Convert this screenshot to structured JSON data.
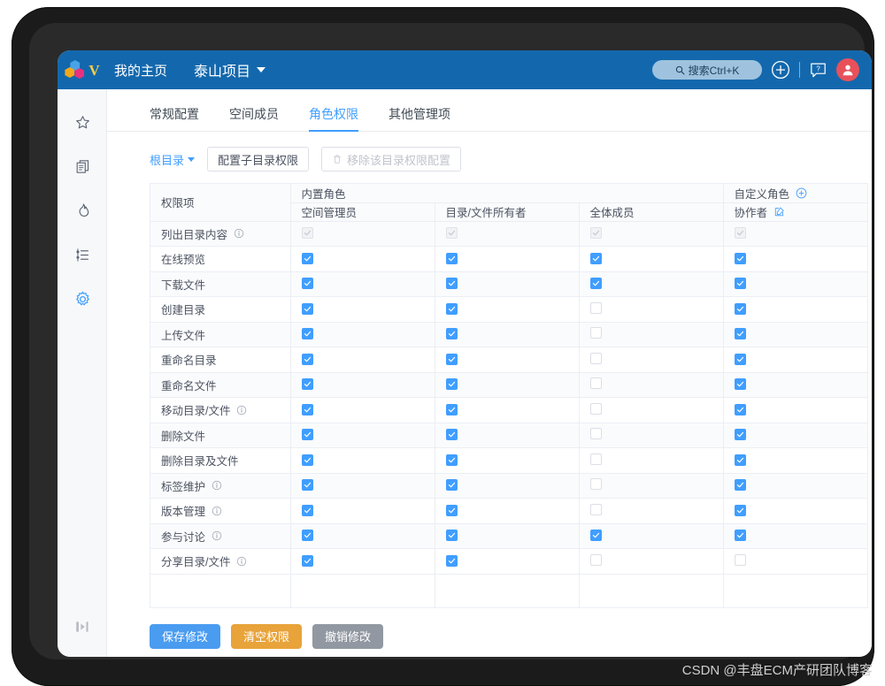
{
  "topbar": {
    "logo_letter": "V",
    "home_label": "我的主页",
    "project_label": "泰山项目",
    "search_placeholder": "搜索Ctrl+K",
    "search_value": "搜索Ctrl+K"
  },
  "tabs": [
    {
      "label": "常规配置",
      "active": false
    },
    {
      "label": "空间成员",
      "active": false
    },
    {
      "label": "角色权限",
      "active": true
    },
    {
      "label": "其他管理项",
      "active": false
    }
  ],
  "toolbar": {
    "root_dir_label": "根目录",
    "config_sub_label": "配置子目录权限",
    "remove_label": "移除该目录权限配置"
  },
  "table": {
    "perm_header": "权限项",
    "builtin_group": "内置角色",
    "custom_group": "自定义角色",
    "columns": [
      "空间管理员",
      "目录/文件所有者",
      "全体成员",
      "协作者"
    ],
    "rows": [
      {
        "label": "列出目录内容",
        "info": true,
        "states": [
          "dis",
          "dis",
          "dis",
          "dis"
        ]
      },
      {
        "label": "在线预览",
        "info": false,
        "states": [
          "on",
          "on",
          "on",
          "on"
        ]
      },
      {
        "label": "下载文件",
        "info": false,
        "states": [
          "on",
          "on",
          "on",
          "on"
        ]
      },
      {
        "label": "创建目录",
        "info": false,
        "states": [
          "on",
          "on",
          "off",
          "on"
        ]
      },
      {
        "label": "上传文件",
        "info": false,
        "states": [
          "on",
          "on",
          "off",
          "on"
        ]
      },
      {
        "label": "重命名目录",
        "info": false,
        "states": [
          "on",
          "on",
          "off",
          "on"
        ]
      },
      {
        "label": "重命名文件",
        "info": false,
        "states": [
          "on",
          "on",
          "off",
          "on"
        ]
      },
      {
        "label": "移动目录/文件",
        "info": true,
        "states": [
          "on",
          "on",
          "off",
          "on"
        ]
      },
      {
        "label": "删除文件",
        "info": false,
        "states": [
          "on",
          "on",
          "off",
          "on"
        ]
      },
      {
        "label": "删除目录及文件",
        "info": false,
        "states": [
          "on",
          "on",
          "off",
          "on"
        ]
      },
      {
        "label": "标签维护",
        "info": true,
        "states": [
          "on",
          "on",
          "off",
          "on"
        ]
      },
      {
        "label": "版本管理",
        "info": true,
        "states": [
          "on",
          "on",
          "off",
          "on"
        ]
      },
      {
        "label": "参与讨论",
        "info": true,
        "states": [
          "on",
          "on",
          "on",
          "on"
        ]
      },
      {
        "label": "分享目录/文件",
        "info": true,
        "states": [
          "on",
          "on",
          "off",
          "off"
        ]
      }
    ]
  },
  "footer": {
    "save_label": "保存修改",
    "clear_label": "清空权限",
    "revert_label": "撤销修改"
  },
  "watermark": "CSDN @丰盘ECM产研团队博客",
  "colors": {
    "topbar": "#1368ad",
    "accent": "#409eff",
    "warn": "#e8a33a",
    "grey": "#9198a1",
    "avatar": "#e8515a"
  }
}
